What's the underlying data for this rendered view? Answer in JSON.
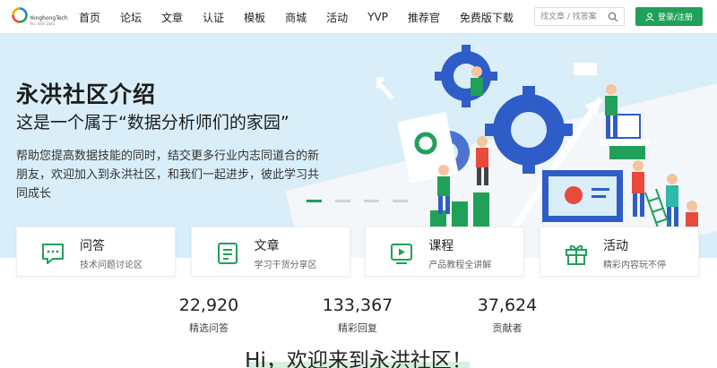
{
  "brand": {
    "name": "YonghongTech",
    "tagline": "Yes, with Data",
    "green": "#21a05a"
  },
  "nav": {
    "items": [
      "首页",
      "论坛",
      "文章",
      "认证",
      "模板",
      "商城",
      "活动",
      "YVP",
      "推荐官",
      "免费版下载"
    ]
  },
  "search": {
    "placeholder": "找文章 / 找答案",
    "icon": "search-icon"
  },
  "login": {
    "label": "登录/注册",
    "icon": "user-icon"
  },
  "hero": {
    "title": "永洪社区介绍",
    "subtitle": "这是一个属于“数据分析师们的家园”",
    "description": "帮助您提高数据技能的同时，结交更多行业内志同道合的新朋友，欢迎加入到永洪社区，和我们一起进步，彼此学习共同成长",
    "carousel": {
      "count": 4,
      "active": 0
    }
  },
  "cards": [
    {
      "title": "问答",
      "desc": "技术问题讨论区",
      "icon": "chat-icon"
    },
    {
      "title": "文章",
      "desc": "学习干货分享区",
      "icon": "document-icon"
    },
    {
      "title": "课程",
      "desc": "产品教程全讲解",
      "icon": "video-icon"
    },
    {
      "title": "活动",
      "desc": "精彩内容玩不停",
      "icon": "gift-icon"
    }
  ],
  "stats": [
    {
      "value": "22,920",
      "label": "精选问答"
    },
    {
      "value": "133,367",
      "label": "精彩回复"
    },
    {
      "value": "37,624",
      "label": "贡献者"
    }
  ],
  "welcome": "Hi，欢迎来到永洪社区！"
}
